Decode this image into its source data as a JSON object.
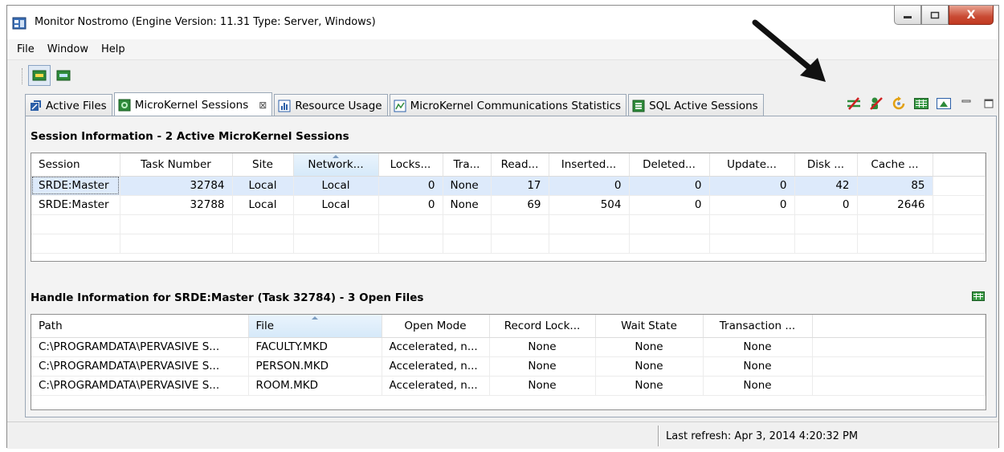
{
  "window": {
    "title": "Monitor Nostromo   (Engine Version: 11.31  Type: Server, Windows)",
    "controls": {
      "close_label": "X"
    }
  },
  "menubar": {
    "items": [
      "File",
      "Window",
      "Help"
    ]
  },
  "tabs": [
    {
      "label": "Active Files",
      "icon": "active-files-icon",
      "active": false
    },
    {
      "label": "MicroKernel Sessions",
      "icon": "sessions-icon",
      "active": true,
      "close": "⊠"
    },
    {
      "label": "Resource Usage",
      "icon": "bar-chart-icon",
      "active": false
    },
    {
      "label": "MicroKernel Communications Statistics",
      "icon": "line-chart-icon",
      "active": false
    },
    {
      "label": "SQL Active Sessions",
      "icon": "sql-icon",
      "active": false
    }
  ],
  "sessions": {
    "title": "Session Information - 2 Active MicroKernel Sessions",
    "columns": [
      "Session",
      "Task Number",
      "Site",
      "Network...",
      "Locks...",
      "Tra...",
      "Read...",
      "Inserted...",
      "Deleted...",
      "Update...",
      "Disk ...",
      "Cache ..."
    ],
    "rows": [
      [
        "SRDE:Master",
        "32784",
        "Local",
        "Local",
        "0",
        "None",
        "17",
        "0",
        "0",
        "0",
        "42",
        "85"
      ],
      [
        "SRDE:Master",
        "32788",
        "Local",
        "Local",
        "0",
        "None",
        "69",
        "504",
        "0",
        "0",
        "0",
        "2646"
      ]
    ]
  },
  "handles": {
    "title": "Handle Information for SRDE:Master (Task 32784) - 3 Open Files",
    "columns": [
      "Path",
      "File",
      "Open Mode",
      "Record Lock...",
      "Wait State",
      "Transaction ..."
    ],
    "rows": [
      [
        "C:\\PROGRAMDATA\\PERVASIVE S...",
        "FACULTY.MKD",
        "Accelerated, n...",
        "None",
        "None",
        "None"
      ],
      [
        "C:\\PROGRAMDATA\\PERVASIVE S...",
        "PERSON.MKD",
        "Accelerated, n...",
        "None",
        "None",
        "None"
      ],
      [
        "C:\\PROGRAMDATA\\PERVASIVE S...",
        "ROOM.MKD",
        "Accelerated, n...",
        "None",
        "None",
        "None"
      ]
    ]
  },
  "status": {
    "last_refresh": "Last refresh: Apr 3, 2014 4:20:32 PM"
  },
  "colors": {
    "selection": "#ddeafb",
    "sorted_header": "#d6e9f9",
    "close_red": "#c94a33"
  }
}
